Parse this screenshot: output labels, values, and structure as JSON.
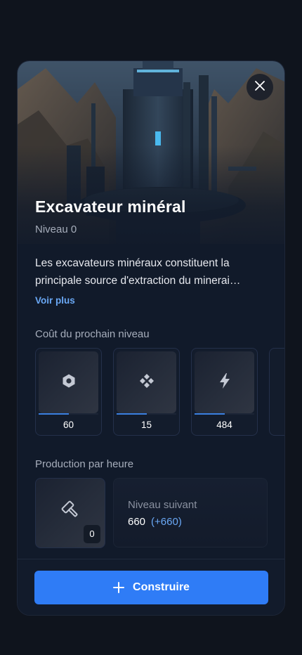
{
  "modal": {
    "title": "Excavateur minéral",
    "level": "Niveau 0",
    "description": "Les excavateurs minéraux constituent la principale source d'extraction du minerai…",
    "see_more": "Voir plus"
  },
  "cost": {
    "label": "Coût du prochain niveau",
    "items": [
      {
        "icon": "hexagon-icon",
        "value": "60",
        "progress": 0.5
      },
      {
        "icon": "diamond-cluster-icon",
        "value": "15",
        "progress": 0.5
      },
      {
        "icon": "lightning-icon",
        "value": "484",
        "progress": 0.5
      }
    ]
  },
  "production": {
    "label": "Production par heure",
    "badge": "0",
    "icon": "hammer-icon",
    "next_label": "Niveau suivant",
    "next_value": "660",
    "next_delta": "(+660)"
  },
  "footer": {
    "build_label": "Construire"
  },
  "colors": {
    "accent": "#2f7cf6",
    "link": "#6aa8f5",
    "background": "#0f141d",
    "card": "#111a2a"
  }
}
